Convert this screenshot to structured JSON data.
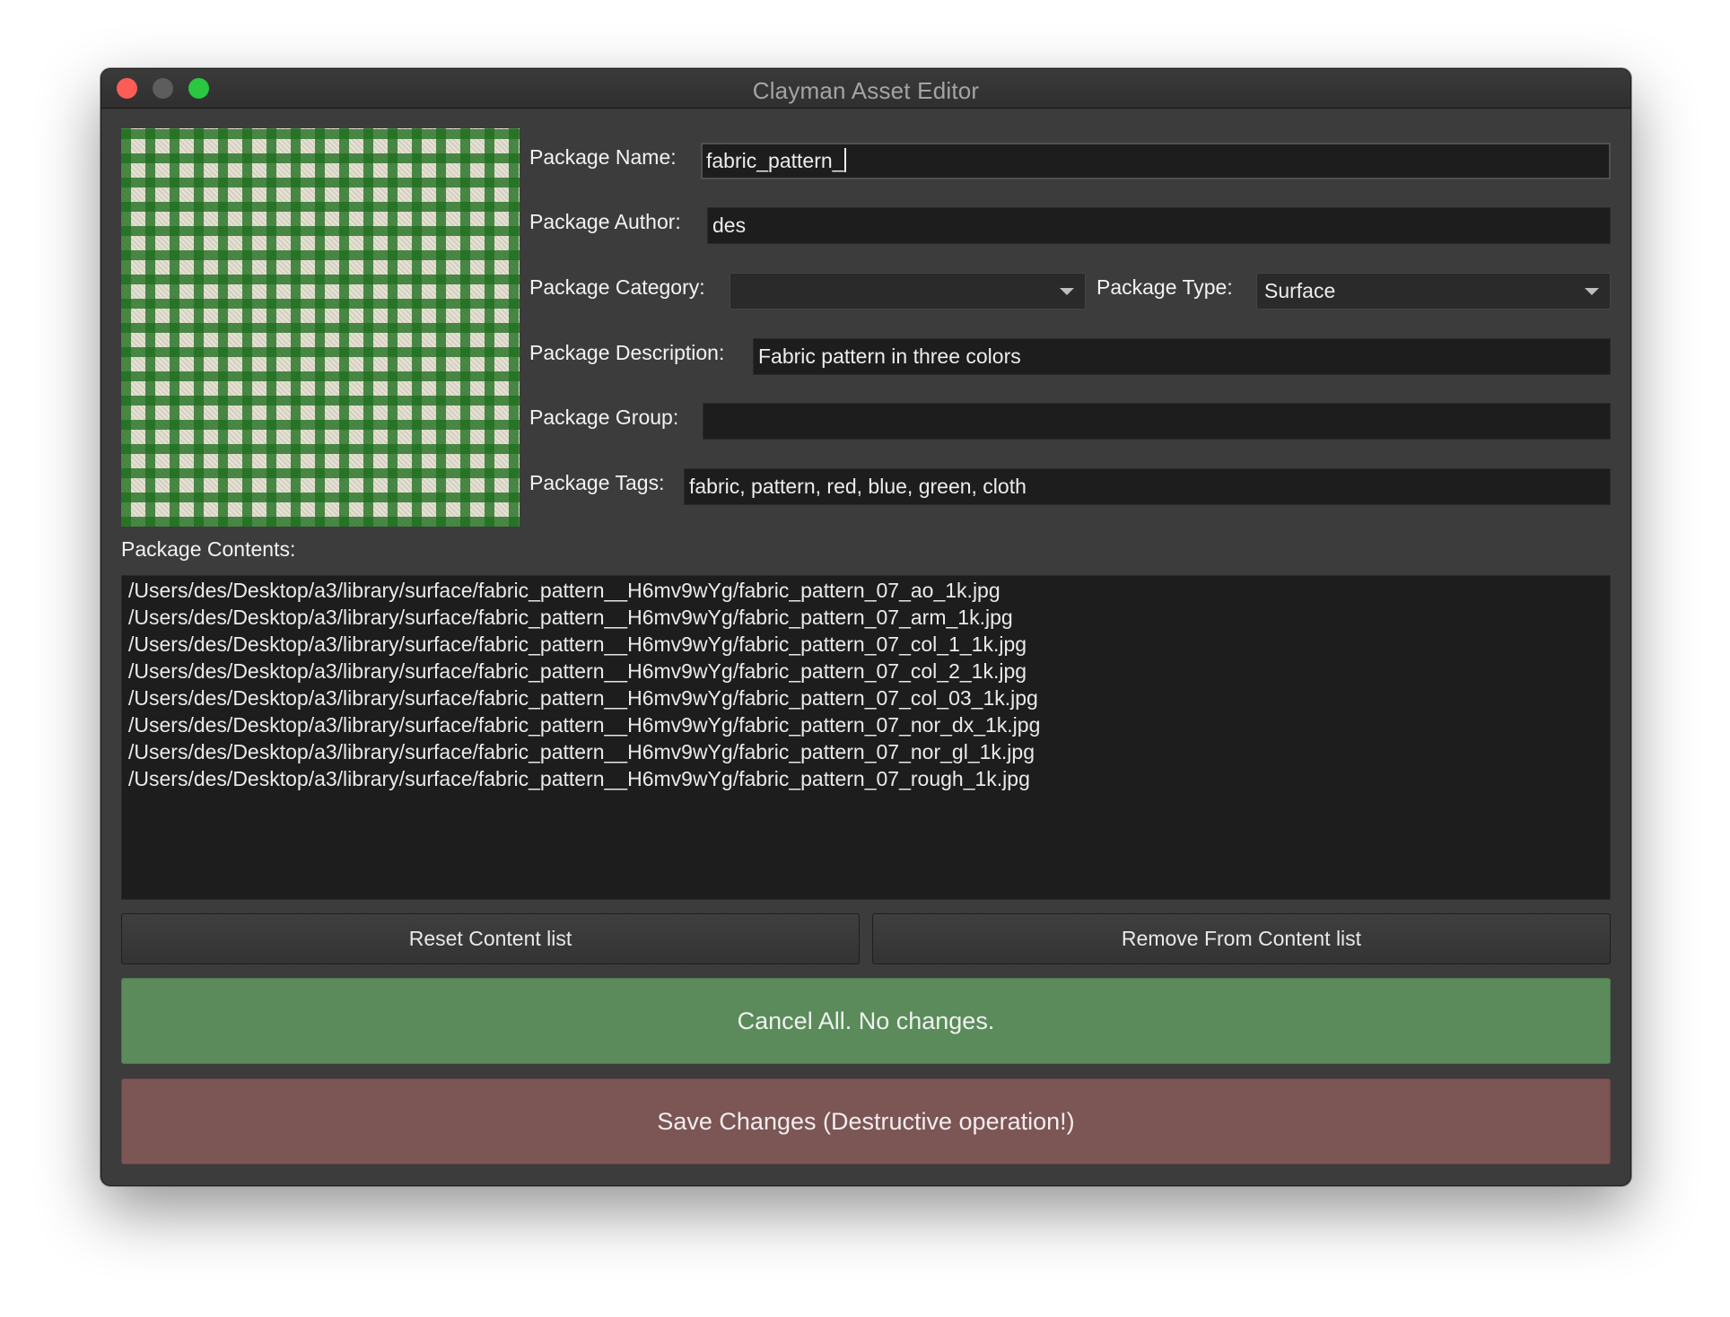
{
  "window": {
    "title": "Clayman Asset Editor"
  },
  "form": {
    "name_label": "Package Name:",
    "name_value": "fabric_pattern_",
    "author_label": "Package Author:",
    "author_value": "des",
    "category_label": "Package Category:",
    "category_value": "",
    "type_label": "Package Type:",
    "type_value": "Surface",
    "description_label": "Package Description:",
    "description_value": "Fabric pattern in three colors",
    "group_label": "Package Group:",
    "group_value": "",
    "tags_label": "Package Tags:",
    "tags_value": "fabric, pattern, red, blue, green, cloth"
  },
  "contents": {
    "label": "Package Contents:",
    "items": [
      "/Users/des/Desktop/a3/library/surface/fabric_pattern__H6mv9wYg/fabric_pattern_07_ao_1k.jpg",
      "/Users/des/Desktop/a3/library/surface/fabric_pattern__H6mv9wYg/fabric_pattern_07_arm_1k.jpg",
      "/Users/des/Desktop/a3/library/surface/fabric_pattern__H6mv9wYg/fabric_pattern_07_col_1_1k.jpg",
      "/Users/des/Desktop/a3/library/surface/fabric_pattern__H6mv9wYg/fabric_pattern_07_col_2_1k.jpg",
      "/Users/des/Desktop/a3/library/surface/fabric_pattern__H6mv9wYg/fabric_pattern_07_col_03_1k.jpg",
      "/Users/des/Desktop/a3/library/surface/fabric_pattern__H6mv9wYg/fabric_pattern_07_nor_dx_1k.jpg",
      "/Users/des/Desktop/a3/library/surface/fabric_pattern__H6mv9wYg/fabric_pattern_07_nor_gl_1k.jpg",
      "/Users/des/Desktop/a3/library/surface/fabric_pattern__H6mv9wYg/fabric_pattern_07_rough_1k.jpg"
    ]
  },
  "buttons": {
    "reset": "Reset Content list",
    "remove": "Remove From Content list",
    "cancel": "Cancel All. No changes.",
    "save": "Save Changes (Destructive operation!)"
  },
  "colors": {
    "window_bg": "#3c3c3c",
    "field_bg": "#1d1d1d",
    "cancel_green": "#5b8a5b",
    "save_red": "#7c5555",
    "close_light": "#fd5d57",
    "max_light": "#2ac840"
  },
  "icons": {
    "preview": "fabric-texture-thumbnail",
    "dropdown": "chevron-down-icon"
  }
}
